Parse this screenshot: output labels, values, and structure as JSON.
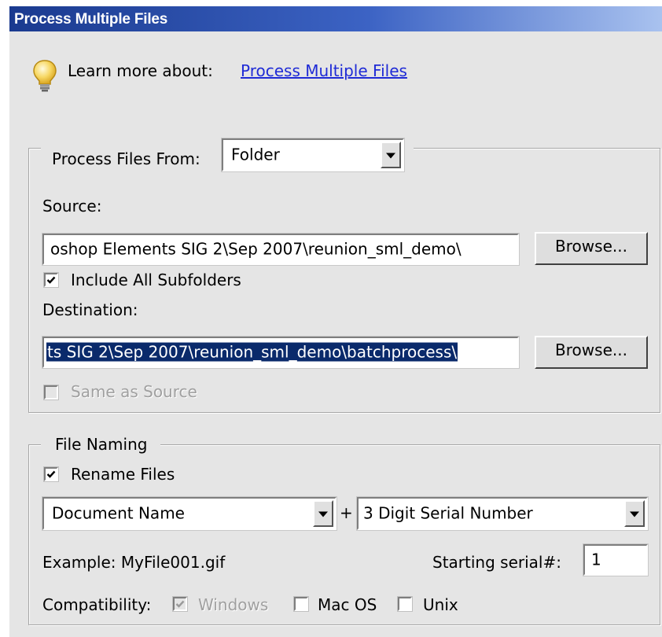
{
  "window": {
    "title": "Process Multiple Files"
  },
  "help": {
    "prefix": "Learn more about:",
    "link": "Process Multiple Files"
  },
  "process_from": {
    "label": "Process Files From:",
    "value": "Folder"
  },
  "source": {
    "label": "Source:",
    "path": "oshop Elements SIG 2\\Sep 2007\\reunion_sml_demo\\",
    "browse_label": "Browse...",
    "include_subfolders": {
      "label": "Include All Subfolders",
      "checked": true
    }
  },
  "destination": {
    "label": "Destination:",
    "path": "ts SIG 2\\Sep 2007\\reunion_sml_demo\\batchprocess\\",
    "browse_label": "Browse...",
    "same_as_source": {
      "label": "Same as Source",
      "checked": false,
      "enabled": false
    }
  },
  "file_naming": {
    "legend": "File Naming",
    "rename": {
      "label": "Rename Files",
      "checked": true
    },
    "name_part": "Document Name",
    "plus": "+",
    "serial_part": "3 Digit Serial Number",
    "example": "Example: MyFile001.gif",
    "starting_serial_label": "Starting serial#:",
    "starting_serial_value": "1",
    "compatibility": {
      "label": "Compatibility:",
      "windows": {
        "label": "Windows",
        "checked": true,
        "enabled": false
      },
      "mac": {
        "label": "Mac OS",
        "checked": false
      },
      "unix": {
        "label": "Unix",
        "checked": false
      }
    }
  },
  "colors": {
    "title_bar": "#1a3a8f",
    "link": "#1f2bd6",
    "selection": "#0a2a6b",
    "panel": "#e5e5e5"
  }
}
